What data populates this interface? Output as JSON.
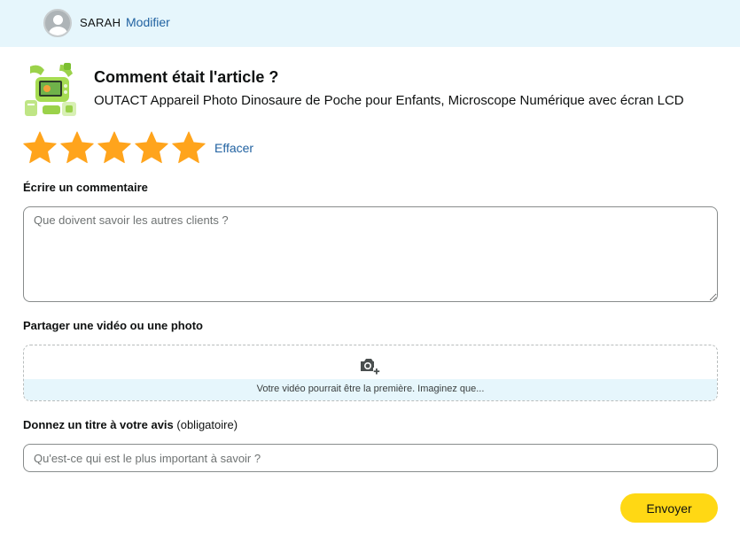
{
  "header": {
    "username": "SARAH",
    "modify_label": "Modifier"
  },
  "review": {
    "question": "Comment était l'article ?",
    "product_name": "OUTACT Appareil Photo Dinosaure de Poche pour Enfants, Microscope Numérique avec écran LCD",
    "rating": 5,
    "rating_max": 5,
    "clear_label": "Effacer",
    "star_color": "#ffa41c"
  },
  "comment": {
    "label": "Écrire un commentaire",
    "placeholder": "Que doivent savoir les autres clients ?",
    "value": ""
  },
  "media": {
    "label": "Partager une vidéo ou une photo",
    "hint": "Votre vidéo pourrait être la première. Imaginez que...",
    "icon": "camera-plus-icon"
  },
  "title_field": {
    "label": "Donnez un titre à votre avis",
    "required_note": "(obligatoire)",
    "placeholder": "Qu'est-ce qui est le plus important à savoir ?",
    "value": ""
  },
  "actions": {
    "submit_label": "Envoyer",
    "submit_color": "#ffd814"
  }
}
